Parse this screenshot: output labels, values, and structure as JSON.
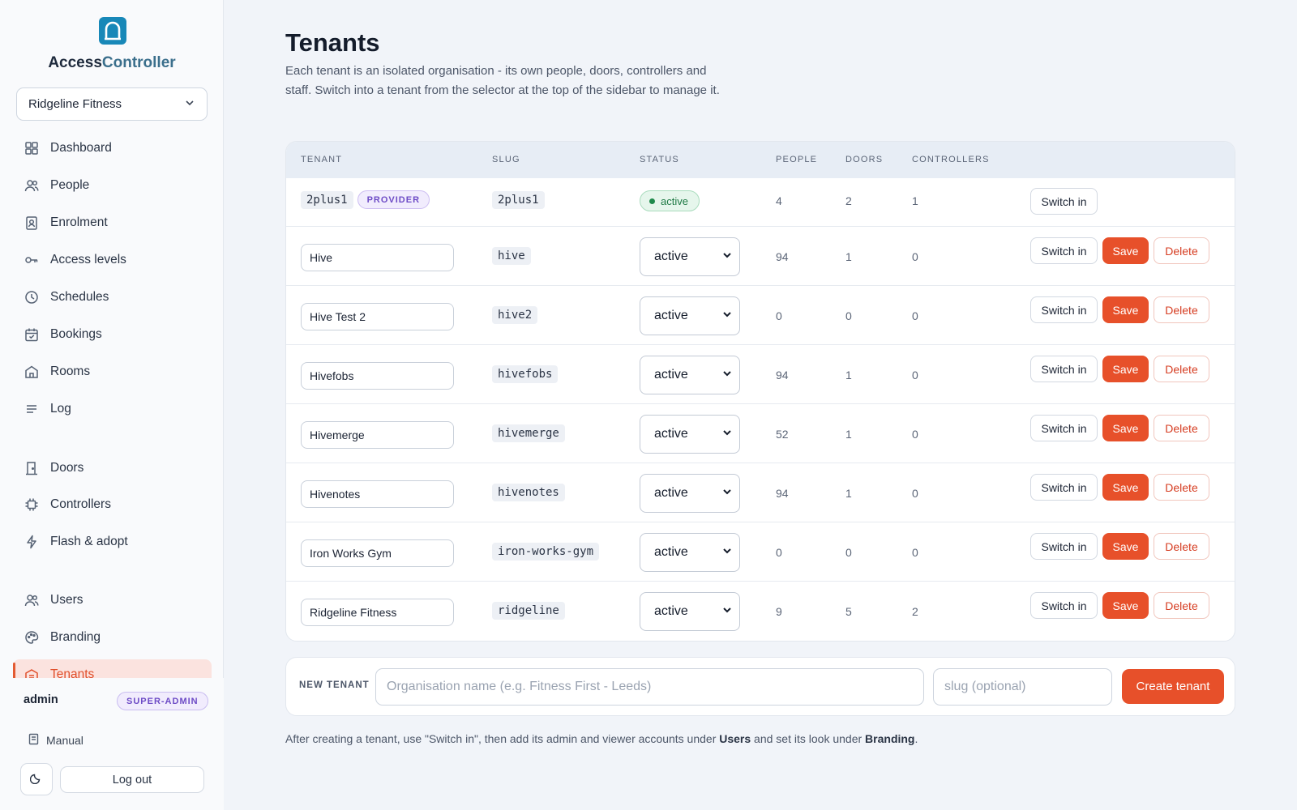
{
  "app": {
    "brand_part1": "Access",
    "brand_part2": "Controller"
  },
  "sidebar": {
    "tenant_selected": "Ridgeline Fitness",
    "items": [
      {
        "label": "Dashboard",
        "icon": "grid-icon"
      },
      {
        "label": "People",
        "icon": "people-icon"
      },
      {
        "label": "Enrolment",
        "icon": "badge-icon"
      },
      {
        "label": "Access levels",
        "icon": "key-icon"
      },
      {
        "label": "Schedules",
        "icon": "clock-icon"
      },
      {
        "label": "Bookings",
        "icon": "calendar-icon"
      },
      {
        "label": "Rooms",
        "icon": "home-icon"
      },
      {
        "label": "Log",
        "icon": "lines-icon"
      },
      {
        "label": "Doors",
        "icon": "door-icon"
      },
      {
        "label": "Controllers",
        "icon": "chip-icon"
      },
      {
        "label": "Flash & adopt",
        "icon": "bolt-icon"
      },
      {
        "label": "Users",
        "icon": "users-icon"
      },
      {
        "label": "Branding",
        "icon": "palette-icon"
      },
      {
        "label": "Tenants",
        "icon": "building-icon",
        "active": true
      }
    ],
    "user": "admin",
    "role_badge": "SUPER-ADMIN",
    "manual_label": "Manual",
    "logout_label": "Log out"
  },
  "page": {
    "title": "Tenants",
    "description": "Each tenant is an isolated organisation - its own people, doors, controllers and staff. Switch into a tenant from the selector at the top of the sidebar to manage it."
  },
  "table": {
    "headers": {
      "tenant": "TENANT",
      "slug": "SLUG",
      "status": "STATUS",
      "people": "PEOPLE",
      "doors": "DOORS",
      "controllers": "CONTROLLERS"
    },
    "first_row": {
      "tenant": "2plus1",
      "badge": "PROVIDER",
      "slug": "2plus1",
      "status": "active",
      "people": "4",
      "doors": "2",
      "controllers": "1",
      "switch": "Switch in"
    },
    "rows": [
      {
        "name": "Hive",
        "slug": "hive",
        "status": "active",
        "people": "94",
        "doors": "1",
        "controllers": "0",
        "switch": "Switch in",
        "save": "Save",
        "delete": "Delete"
      },
      {
        "name": "Hive Test 2",
        "slug": "hive2",
        "status": "active",
        "people": "0",
        "doors": "0",
        "controllers": "0",
        "switch": "Switch in",
        "save": "Save",
        "delete": "Delete"
      },
      {
        "name": "Hivefobs",
        "slug": "hivefobs",
        "status": "active",
        "people": "94",
        "doors": "1",
        "controllers": "0",
        "switch": "Switch in",
        "save": "Save",
        "delete": "Delete"
      },
      {
        "name": "Hivemerge",
        "slug": "hivemerge",
        "status": "active",
        "people": "52",
        "doors": "1",
        "controllers": "0",
        "switch": "Switch in",
        "save": "Save",
        "delete": "Delete"
      },
      {
        "name": "Hivenotes",
        "slug": "hivenotes",
        "status": "active",
        "people": "94",
        "doors": "1",
        "controllers": "0",
        "switch": "Switch in",
        "save": "Save",
        "delete": "Delete"
      },
      {
        "name": "Iron Works Gym",
        "slug": "iron-works-gym",
        "status": "active",
        "people": "0",
        "doors": "0",
        "controllers": "0",
        "switch": "Switch in",
        "save": "Save",
        "delete": "Delete"
      },
      {
        "name": "Ridgeline Fitness",
        "slug": "ridgeline",
        "status": "active",
        "people": "9",
        "doors": "5",
        "controllers": "2",
        "switch": "Switch in",
        "save": "Save",
        "delete": "Delete"
      }
    ]
  },
  "new_tenant": {
    "label": "NEW TENANT",
    "name_placeholder": "Organisation name (e.g. Fitness First - Leeds)",
    "slug_placeholder": "slug (optional)",
    "create_label": "Create tenant"
  },
  "footnote": {
    "part1": "After creating a tenant, use \"Switch in\", then add its admin and viewer accounts under ",
    "users": "Users",
    "part2": " and set its look under ",
    "branding": "Branding",
    "part3": "."
  },
  "colors": {
    "accent": "#e7502a",
    "brand_icon": "#1888b8",
    "active_status": "#1f7a45"
  }
}
